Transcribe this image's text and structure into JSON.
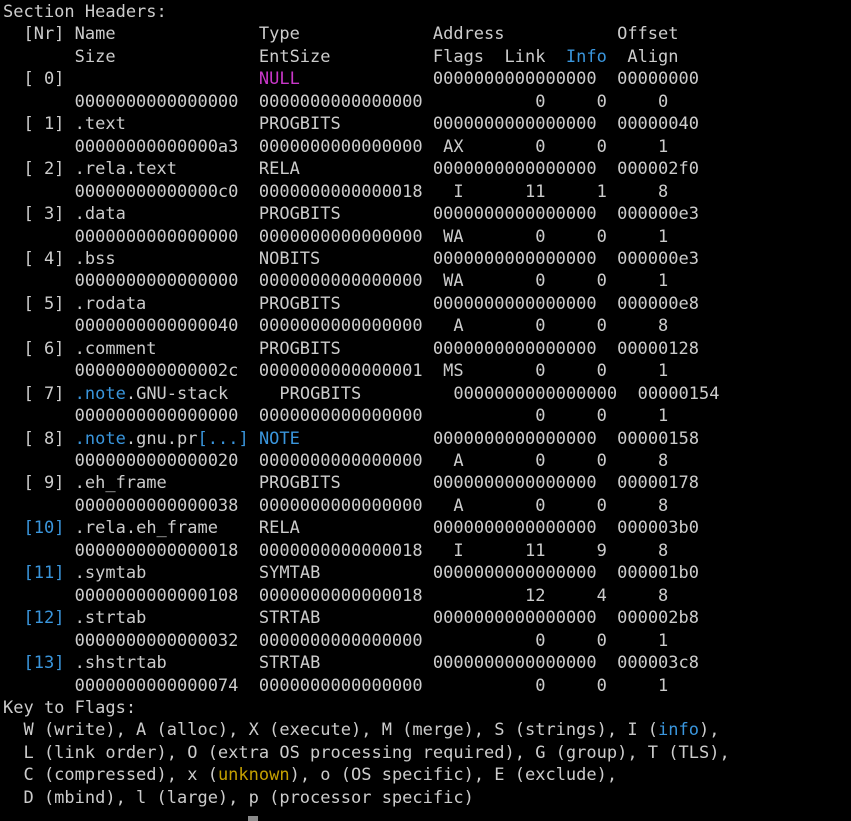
{
  "terminal": {
    "lines": [
      [
        [
          "Section Headers:",
          "default"
        ]
      ],
      [
        [
          "  [Nr] Name              Type             Address           Offset",
          "default"
        ]
      ],
      [
        [
          "       Size              EntSize          Flags  Link  ",
          "default"
        ],
        [
          "Info",
          "cyan"
        ],
        [
          "  Align",
          "default"
        ]
      ],
      [
        [
          "  [ 0]                   ",
          "default"
        ],
        [
          "NULL",
          "magenta"
        ],
        [
          "             0000000000000000  00000000",
          "default"
        ]
      ],
      [
        [
          "       0000000000000000  0000000000000000           0     0     0",
          "default"
        ]
      ],
      [
        [
          "  [ 1] .text             PROGBITS         0000000000000000  00000040",
          "default"
        ]
      ],
      [
        [
          "       00000000000000a3  0000000000000000  AX       0     0     1",
          "default"
        ]
      ],
      [
        [
          "  [ 2] .rela.text        RELA             0000000000000000  000002f0",
          "default"
        ]
      ],
      [
        [
          "       00000000000000c0  0000000000000018   I      11     1     8",
          "default"
        ]
      ],
      [
        [
          "  [ 3] .data             PROGBITS         0000000000000000  000000e3",
          "default"
        ]
      ],
      [
        [
          "       0000000000000000  0000000000000000  WA       0     0     1",
          "default"
        ]
      ],
      [
        [
          "  [ 4] .bss              NOBITS           0000000000000000  000000e3",
          "default"
        ]
      ],
      [
        [
          "       0000000000000000  0000000000000000  WA       0     0     1",
          "default"
        ]
      ],
      [
        [
          "  [ 5] .rodata           PROGBITS         0000000000000000  000000e8",
          "default"
        ]
      ],
      [
        [
          "       0000000000000040  0000000000000000   A       0     0     8",
          "default"
        ]
      ],
      [
        [
          "  [ 6] .comment          PROGBITS         0000000000000000  00000128",
          "default"
        ]
      ],
      [
        [
          "       000000000000002c  0000000000000001  MS       0     0     1",
          "default"
        ]
      ],
      [
        [
          "  [ 7] ",
          "default"
        ],
        [
          ".note",
          "cyan"
        ],
        [
          ".GNU-stack     PROGBITS         0000000000000000  00000154",
          "default"
        ]
      ],
      [
        [
          "       0000000000000000  0000000000000000           0     0     1",
          "default"
        ]
      ],
      [
        [
          "  [ 8] ",
          "default"
        ],
        [
          ".note",
          "cyan"
        ],
        [
          ".gnu.pr",
          "default"
        ],
        [
          "[...]",
          "cyan"
        ],
        [
          " ",
          "default"
        ],
        [
          "NOTE",
          "cyan"
        ],
        [
          "             0000000000000000  00000158",
          "default"
        ]
      ],
      [
        [
          "       0000000000000020  0000000000000000   A       0     0     8",
          "default"
        ]
      ],
      [
        [
          "  [ 9] .eh_frame         PROGBITS         0000000000000000  00000178",
          "default"
        ]
      ],
      [
        [
          "       0000000000000038  0000000000000000   A       0     0     8",
          "default"
        ]
      ],
      [
        [
          "  ",
          "default"
        ],
        [
          "[10]",
          "cyan"
        ],
        [
          " .rela.eh_frame    RELA             0000000000000000  000003b0",
          "default"
        ]
      ],
      [
        [
          "       0000000000000018  0000000000000018   I      11     9     8",
          "default"
        ]
      ],
      [
        [
          "  ",
          "default"
        ],
        [
          "[11]",
          "cyan"
        ],
        [
          " .symtab           SYMTAB           0000000000000000  000001b0",
          "default"
        ]
      ],
      [
        [
          "       0000000000000108  0000000000000018          12     4     8",
          "default"
        ]
      ],
      [
        [
          "  ",
          "default"
        ],
        [
          "[12]",
          "cyan"
        ],
        [
          " .strtab           STRTAB           0000000000000000  000002b8",
          "default"
        ]
      ],
      [
        [
          "       0000000000000032  0000000000000000           0     0     1",
          "default"
        ]
      ],
      [
        [
          "  ",
          "default"
        ],
        [
          "[13]",
          "cyan"
        ],
        [
          " .shstrtab         STRTAB           0000000000000000  000003c8",
          "default"
        ]
      ],
      [
        [
          "       0000000000000074  0000000000000000           0     0     1",
          "default"
        ]
      ],
      [
        [
          "Key to Flags:",
          "default"
        ]
      ],
      [
        [
          "  W (write), A (alloc), X (execute), M (merge), S (strings), I (",
          "default"
        ],
        [
          "info",
          "cyan"
        ],
        [
          "),",
          "default"
        ]
      ],
      [
        [
          "  L (link order), O (extra OS processing required), G (group), T (TLS),",
          "default"
        ]
      ],
      [
        [
          "  C (compressed), x (",
          "default"
        ],
        [
          "unknown",
          "yellow"
        ],
        [
          "), o (OS specific), E (exclude),",
          "default"
        ]
      ],
      [
        [
          "  D (mbind), l (large), p (processor specific)",
          "default"
        ]
      ]
    ]
  },
  "colors": {
    "background": "#000000",
    "default": "#cccccc",
    "cyan": "#3a96dd",
    "magenta": "#c837c8",
    "yellow": "#c4a000"
  }
}
